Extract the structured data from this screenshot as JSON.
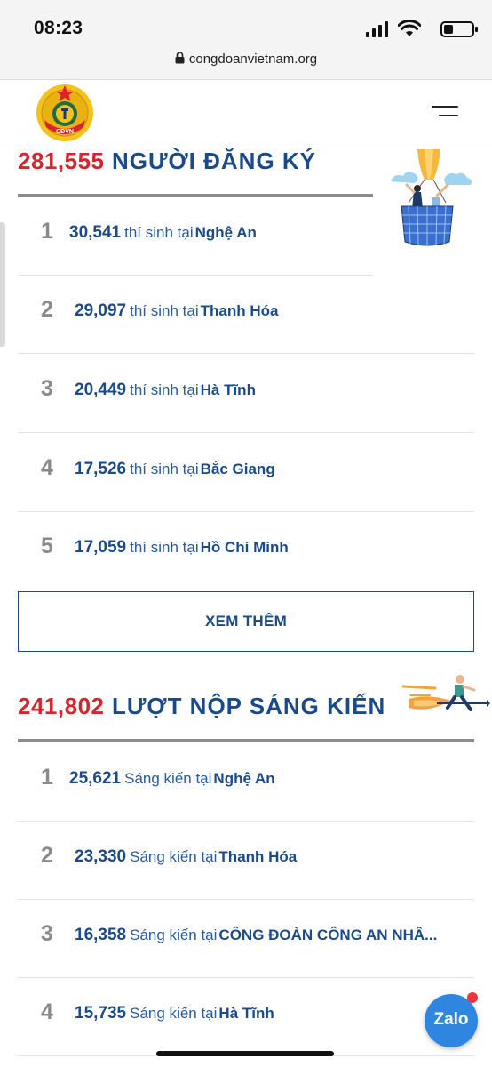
{
  "status_bar": {
    "time": "08:23"
  },
  "browser": {
    "url": "congdoanvietnam.org"
  },
  "logo": {
    "text": "CĐVN"
  },
  "colors": {
    "accent_red": "#d9232d",
    "brand_blue": "#1b4a8a",
    "zalo_blue": "#2f86e0"
  },
  "registrations": {
    "count": "281,555",
    "title": "NGƯỜI ĐĂNG KÝ",
    "items": [
      {
        "rank": "1",
        "number": "30,541",
        "middle": "thí sinh tại",
        "place": "Nghệ An"
      },
      {
        "rank": "2",
        "number": "29,097",
        "middle": "thí sinh tại",
        "place": "Thanh Hóa"
      },
      {
        "rank": "3",
        "number": "20,449",
        "middle": "thí sinh tại",
        "place": "Hà Tĩnh"
      },
      {
        "rank": "4",
        "number": "17,526",
        "middle": "thí sinh tại",
        "place": "Bắc Giang"
      },
      {
        "rank": "5",
        "number": "17,059",
        "middle": "thí sinh tại",
        "place": "Hồ Chí Minh"
      }
    ],
    "more_label": "XEM THÊM"
  },
  "initiatives": {
    "count": "241,802",
    "title": "LƯỢT NỘP SÁNG KIẾN",
    "items": [
      {
        "rank": "1",
        "number": "25,621",
        "middle": "Sáng kiến tại",
        "place": "Nghệ An"
      },
      {
        "rank": "2",
        "number": "23,330",
        "middle": "Sáng kiến tại",
        "place": "Thanh Hóa"
      },
      {
        "rank": "3",
        "number": "16,358",
        "middle": "Sáng kiến tại",
        "place": "CÔNG ĐOÀN CÔNG AN NHÂ..."
      },
      {
        "rank": "4",
        "number": "15,735",
        "middle": "Sáng kiến tại",
        "place": "Hà Tĩnh"
      }
    ]
  },
  "zalo": {
    "label": "Zalo"
  }
}
